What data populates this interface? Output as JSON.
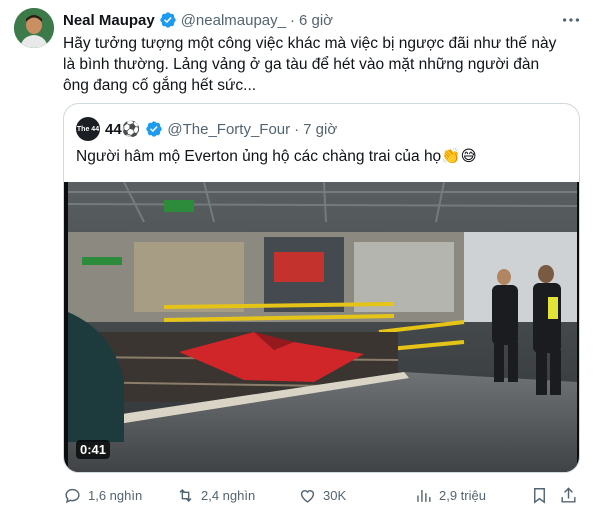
{
  "tweet": {
    "author_name": "Neal Maupay",
    "handle": "@nealmaupay_",
    "separator": "·",
    "time": "6 giờ",
    "text": "Hãy tưởng tượng một công việc khác mà việc bị ngược đãi như thế này là bình thường. Lảng vảng ở ga tàu để hét vào mặt những người đàn ông đang cố gắng hết sức...",
    "verified": true
  },
  "quoted": {
    "avatar_text": "The 44",
    "author_name": "44⚽",
    "handle": "@The_Forty_Four",
    "separator": "·",
    "time": "7 giờ",
    "text": "Người hâm mộ Everton ủng hộ các chàng trai của họ👏😅",
    "video_duration": "0:41"
  },
  "actions": {
    "replies": "1,6 nghìn",
    "reposts": "2,4 nghìn",
    "likes": "30K",
    "views": "2,9 triệu"
  },
  "colors": {
    "verified_blue": "#1d9bf0",
    "muted": "#536471",
    "border": "#cfd9de",
    "text": "#0f1419"
  }
}
